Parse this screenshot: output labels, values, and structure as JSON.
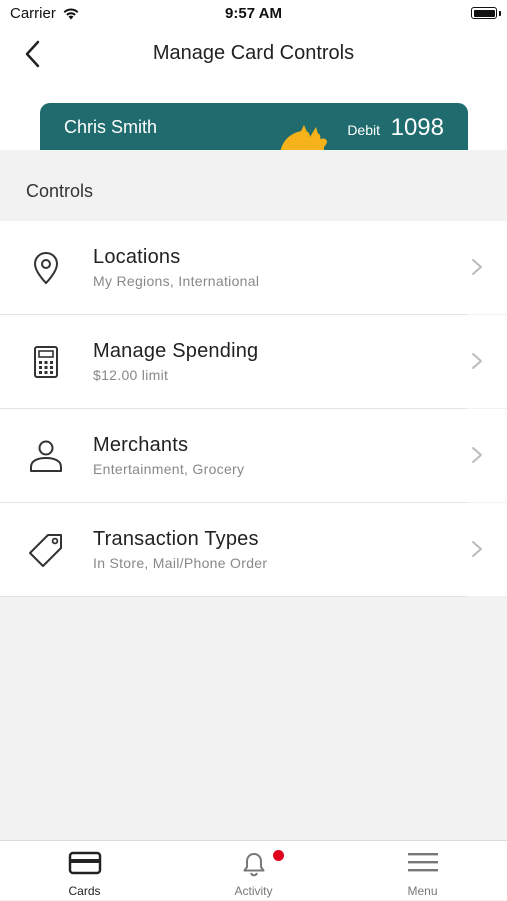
{
  "status_bar": {
    "carrier": "Carrier",
    "time": "9:57 AM"
  },
  "header": {
    "title": "Manage Card Controls"
  },
  "card": {
    "name": "Chris Smith",
    "type": "Debit",
    "last4": "1098",
    "color": "#1f6b6d"
  },
  "controls": {
    "section_label": "Controls",
    "items": [
      {
        "title": "Locations",
        "subtitle": "My Regions, International",
        "icon": "location-pin-icon"
      },
      {
        "title": "Manage Spending",
        "subtitle": "$12.00 limit",
        "icon": "calculator-icon"
      },
      {
        "title": "Merchants",
        "subtitle": "Entertainment, Grocery",
        "icon": "person-icon"
      },
      {
        "title": "Transaction Types",
        "subtitle": "In Store, Mail/Phone Order",
        "icon": "tag-icon"
      }
    ]
  },
  "tab_bar": {
    "tabs": [
      {
        "label": "Cards",
        "icon": "card-icon",
        "active": true
      },
      {
        "label": "Activity",
        "icon": "bell-icon",
        "active": false,
        "badge": true
      },
      {
        "label": "Menu",
        "icon": "hamburger-icon",
        "active": false
      }
    ],
    "badge_color": "#e0001b"
  }
}
